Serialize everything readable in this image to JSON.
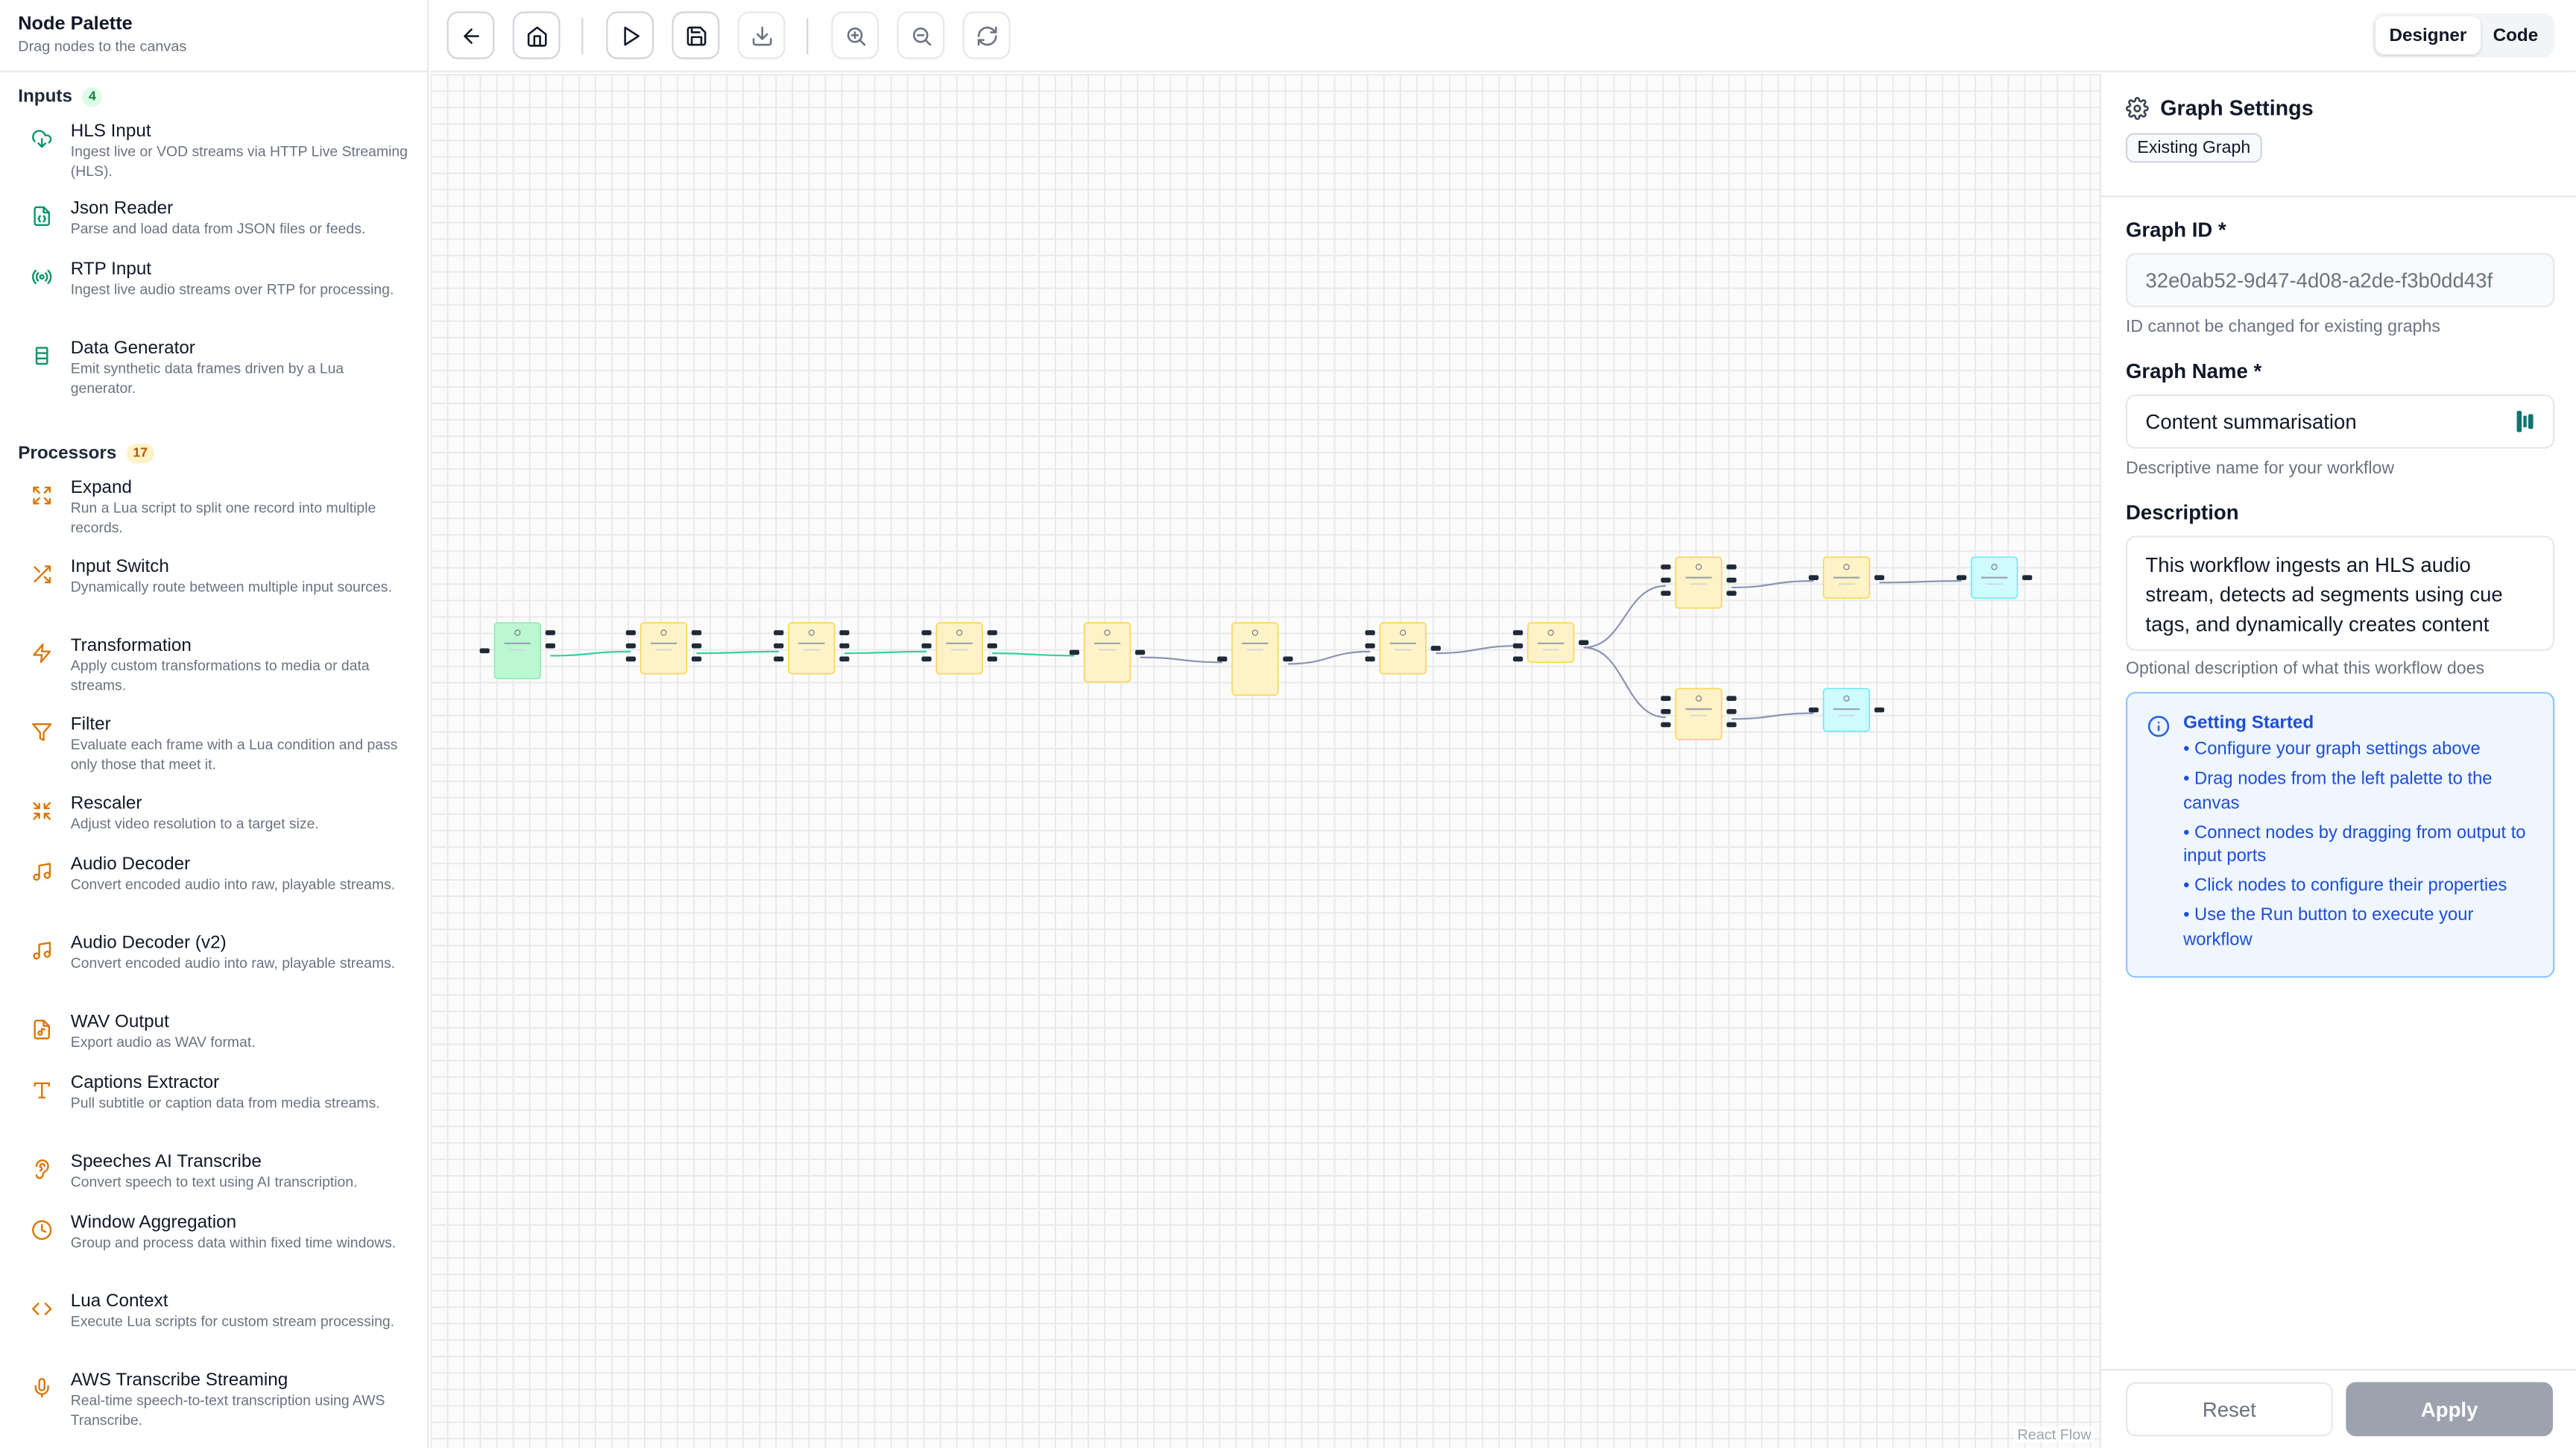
{
  "palette": {
    "title": "Node Palette",
    "subtitle": "Drag nodes to the canvas",
    "inputs": {
      "label": "Inputs",
      "count": "4",
      "items": [
        {
          "name": "HLS Input",
          "desc": "Ingest live or VOD streams via HTTP Live Streaming (HLS).",
          "icon": "cloud-download-icon"
        },
        {
          "name": "Json Reader",
          "desc": "Parse and load data from JSON files or feeds.",
          "icon": "file-json-icon"
        },
        {
          "name": "RTP Input",
          "desc": "Ingest live audio streams over RTP for processing.",
          "icon": "radio-icon"
        },
        {
          "name": "Data Generator",
          "desc": "Emit synthetic data frames driven by a Lua generator.",
          "icon": "cylinder-icon"
        }
      ]
    },
    "processors": {
      "label": "Processors",
      "count": "17",
      "items": [
        {
          "name": "Expand",
          "desc": "Run a Lua script to split one record into multiple records.",
          "icon": "expand-icon"
        },
        {
          "name": "Input Switch",
          "desc": "Dynamically route between multiple input sources.",
          "icon": "shuffle-icon"
        },
        {
          "name": "Transformation",
          "desc": "Apply custom transformations to media or data streams.",
          "icon": "zap-icon"
        },
        {
          "name": "Filter",
          "desc": "Evaluate each frame with a Lua condition and pass only those that meet it.",
          "icon": "filter-icon"
        },
        {
          "name": "Rescaler",
          "desc": "Adjust video resolution to a target size.",
          "icon": "shrink-icon"
        },
        {
          "name": "Audio Decoder",
          "desc": "Convert encoded audio into raw, playable streams.",
          "icon": "music-icon"
        },
        {
          "name": "Audio Decoder (v2)",
          "desc": "Convert encoded audio into raw, playable streams.",
          "icon": "music-icon"
        },
        {
          "name": "WAV Output",
          "desc": "Export audio as WAV format.",
          "icon": "file-audio-icon"
        },
        {
          "name": "Captions Extractor",
          "desc": "Pull subtitle or caption data from media streams.",
          "icon": "type-icon"
        },
        {
          "name": "Speeches AI Transcribe",
          "desc": "Convert speech to text using AI transcription.",
          "icon": "ear-icon"
        },
        {
          "name": "Window Aggregation",
          "desc": "Group and process data within fixed time windows.",
          "icon": "clock-icon"
        },
        {
          "name": "Lua Context",
          "desc": "Execute Lua scripts for custom stream processing.",
          "icon": "code-icon"
        },
        {
          "name": "AWS Transcribe Streaming",
          "desc": "Real-time speech-to-text transcription using AWS Transcribe.",
          "icon": "mic-icon"
        }
      ]
    }
  },
  "toolbar": {
    "buttons": [
      {
        "name": "back-button",
        "icon": "arrow-left-icon"
      },
      {
        "name": "home-button",
        "icon": "home-icon"
      },
      {
        "name": "run-button",
        "icon": "play-icon"
      },
      {
        "name": "save-button",
        "icon": "save-icon"
      },
      {
        "name": "download-button",
        "icon": "download-icon"
      },
      {
        "name": "zoom-in-button",
        "icon": "zoom-in-icon"
      },
      {
        "name": "zoom-out-button",
        "icon": "zoom-out-icon"
      },
      {
        "name": "refresh-button",
        "icon": "refresh-icon"
      }
    ],
    "view_toggle": {
      "designer": "Designer",
      "code": "Code",
      "active": "Designer"
    }
  },
  "canvas": {
    "attribution": "React Flow",
    "nodes": [
      {
        "id": "n1",
        "kind": "input"
      },
      {
        "id": "n2",
        "kind": "processor"
      },
      {
        "id": "n3",
        "kind": "processor"
      },
      {
        "id": "n4",
        "kind": "processor"
      },
      {
        "id": "n5",
        "kind": "processor"
      },
      {
        "id": "n6",
        "kind": "processor"
      },
      {
        "id": "n7",
        "kind": "processor"
      },
      {
        "id": "n8",
        "kind": "processor"
      },
      {
        "id": "n9",
        "kind": "processor"
      },
      {
        "id": "n10",
        "kind": "processor"
      },
      {
        "id": "n11",
        "kind": "output"
      },
      {
        "id": "n12",
        "kind": "processor"
      },
      {
        "id": "n13",
        "kind": "output"
      }
    ],
    "edges": [
      [
        "n1",
        "n2"
      ],
      [
        "n2",
        "n3"
      ],
      [
        "n3",
        "n4"
      ],
      [
        "n4",
        "n5"
      ],
      [
        "n5",
        "n6"
      ],
      [
        "n6",
        "n7"
      ],
      [
        "n7",
        "n8"
      ],
      [
        "n8",
        "n9"
      ],
      [
        "n9",
        "n10"
      ],
      [
        "n10",
        "n11"
      ],
      [
        "n8",
        "n12"
      ],
      [
        "n12",
        "n13"
      ]
    ],
    "colors": {
      "input": "#bbf7d0",
      "processor": "#fef3c7",
      "output": "#cffafe",
      "edge": "#8b93b5",
      "edge_green": "#34d399"
    }
  },
  "settings": {
    "title": "Graph Settings",
    "badge": "Existing Graph",
    "graph_id_label": "Graph ID *",
    "graph_id_value": "32e0ab52-9d47-4d08-a2de-f3b0dd43f",
    "graph_id_hint": "ID cannot be changed for existing graphs",
    "graph_name_label": "Graph Name *",
    "graph_name_value": "Content summarisation",
    "graph_name_hint": "Descriptive name for your workflow",
    "description_label": "Description",
    "description_value": "This workflow ingests an HLS audio stream, detects ad segments using cue tags, and dynamically creates content",
    "description_hint": "Optional description of what this workflow does",
    "getting_started": {
      "title": "Getting Started",
      "items": [
        "• Configure your graph settings above",
        "• Drag nodes from the left palette to the canvas",
        "• Connect nodes by dragging from output to input ports",
        "• Click nodes to configure their properties",
        "• Use the Run button to execute your workflow"
      ]
    },
    "reset_label": "Reset",
    "apply_label": "Apply"
  }
}
